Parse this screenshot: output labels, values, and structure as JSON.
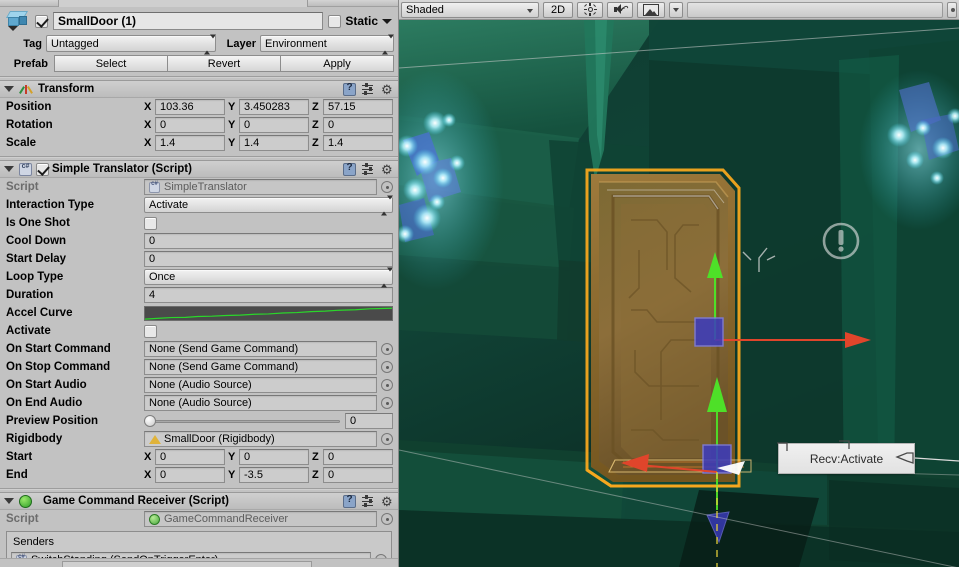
{
  "inspector": {
    "object": {
      "icon": "prefab-cube-icon",
      "enabled_checkbox": true,
      "name": "SmallDoor (1)",
      "static_label": "Static",
      "static_checked": false
    },
    "tag_label": "Tag",
    "tag_value": "Untagged",
    "layer_label": "Layer",
    "layer_value": "Environment",
    "prefab_label": "Prefab",
    "prefab_buttons": [
      "Select",
      "Revert",
      "Apply"
    ],
    "components": [
      {
        "title": "Transform",
        "icon": "transform-axis-icon",
        "has_enable_checkbox": false,
        "rows": [
          {
            "type": "vector3",
            "label": "Position",
            "x": "103.36",
            "y": "3.450283",
            "z": "57.15"
          },
          {
            "type": "vector3",
            "label": "Rotation",
            "x": "0",
            "y": "0",
            "z": "0"
          },
          {
            "type": "vector3",
            "label": "Scale",
            "x": "1.4",
            "y": "1.4",
            "z": "1.4"
          }
        ]
      },
      {
        "title": "Simple Translator (Script)",
        "icon": "csharp-script-icon",
        "has_enable_checkbox": true,
        "enabled": true,
        "rows": [
          {
            "type": "object",
            "label": "Script",
            "value": "SimpleTranslator",
            "icon": "csharp-script-icon",
            "readonly": true
          },
          {
            "type": "popup",
            "label": "Interaction Type",
            "value": "Activate"
          },
          {
            "type": "checkbox",
            "label": "Is One Shot",
            "checked": false
          },
          {
            "type": "text",
            "label": "Cool Down",
            "value": "0"
          },
          {
            "type": "text",
            "label": "Start Delay",
            "value": "0"
          },
          {
            "type": "popup",
            "label": "Loop Type",
            "value": "Once"
          },
          {
            "type": "text",
            "label": "Duration",
            "value": "4"
          },
          {
            "type": "curve",
            "label": "Accel Curve"
          },
          {
            "type": "checkbox",
            "label": "Activate",
            "checked": false
          },
          {
            "type": "object",
            "label": "On Start Command",
            "value": "None (Send Game Command)"
          },
          {
            "type": "object",
            "label": "On Stop Command",
            "value": "None (Send Game Command)"
          },
          {
            "type": "object",
            "label": "On Start Audio",
            "value": "None (Audio Source)"
          },
          {
            "type": "object",
            "label": "On End Audio",
            "value": "None (Audio Source)"
          },
          {
            "type": "slider",
            "label": "Preview Position",
            "value": "0",
            "percent": 0
          },
          {
            "type": "object",
            "label": "Rigidbody",
            "value": "SmallDoor (Rigidbody)",
            "icon": "rigidbody-icon"
          },
          {
            "type": "vector3",
            "label": "Start",
            "x": "0",
            "y": "0",
            "z": "0"
          },
          {
            "type": "vector3",
            "label": "End",
            "x": "0",
            "y": "-3.5",
            "z": "0"
          }
        ]
      },
      {
        "title": "Game Command Receiver (Script)",
        "icon": "green-script-icon",
        "has_enable_checkbox": false,
        "rows": [
          {
            "type": "object",
            "label": "Script",
            "value": "GameCommandReceiver",
            "icon": "green-script-icon",
            "readonly": true
          }
        ],
        "list": {
          "header": "Senders",
          "items": [
            {
              "value": "SwitchStanding (SendOnTriggerEnter)",
              "icon": "csharp-script-icon"
            }
          ]
        }
      }
    ],
    "axis_labels": {
      "x": "X",
      "y": "Y",
      "z": "Z"
    }
  },
  "scene": {
    "toolbar": {
      "draw_mode": "Shaded",
      "two_d": "2D",
      "lighting_icon": "sun-icon",
      "audio_icon": "speaker-icon",
      "effects_icon": "image-icon",
      "effects_caret": "chevron-down-icon"
    },
    "overlay_label": "Recv:Activate",
    "gizmo_icon": "exclamation-circle-gizmo-icon"
  },
  "colors": {
    "selection_outline": "#f6a71e",
    "axis_x": "#e0452b",
    "axis_y": "#4ee028",
    "axis_z": "#4a4ad0",
    "curve_line": "#2ad72a",
    "cave_green": "#14503f",
    "crystal_glow": "#9ff4ff",
    "panel_bg": "#c2c2c2"
  }
}
